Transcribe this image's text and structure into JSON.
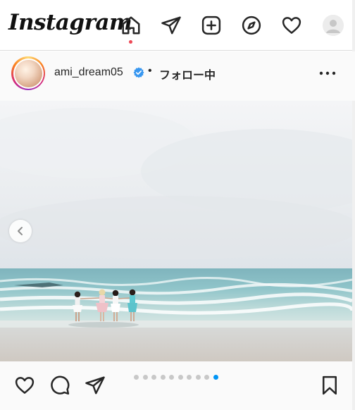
{
  "nav": {
    "logo": "Instagram",
    "icons": [
      "home-icon",
      "direct-message-icon",
      "new-post-icon",
      "explore-icon",
      "activity-heart-icon",
      "profile-avatar-icon"
    ],
    "active": "home",
    "notification_dot_color": "#ed4956"
  },
  "post": {
    "username": "ami_dream05",
    "verified": true,
    "separator": "•",
    "follow_label": "フォロー中",
    "more_icon": "more-options-icon",
    "photo": {
      "subject": "four-women-holding-hands-on-beach",
      "carousel_total": 10,
      "carousel_current": 10
    },
    "actions": [
      "like-heart-icon",
      "comment-icon",
      "share-icon",
      "save-bookmark-icon"
    ]
  },
  "colors": {
    "accent": "#0095f6",
    "verified": "#3897f0",
    "text": "#262626"
  }
}
